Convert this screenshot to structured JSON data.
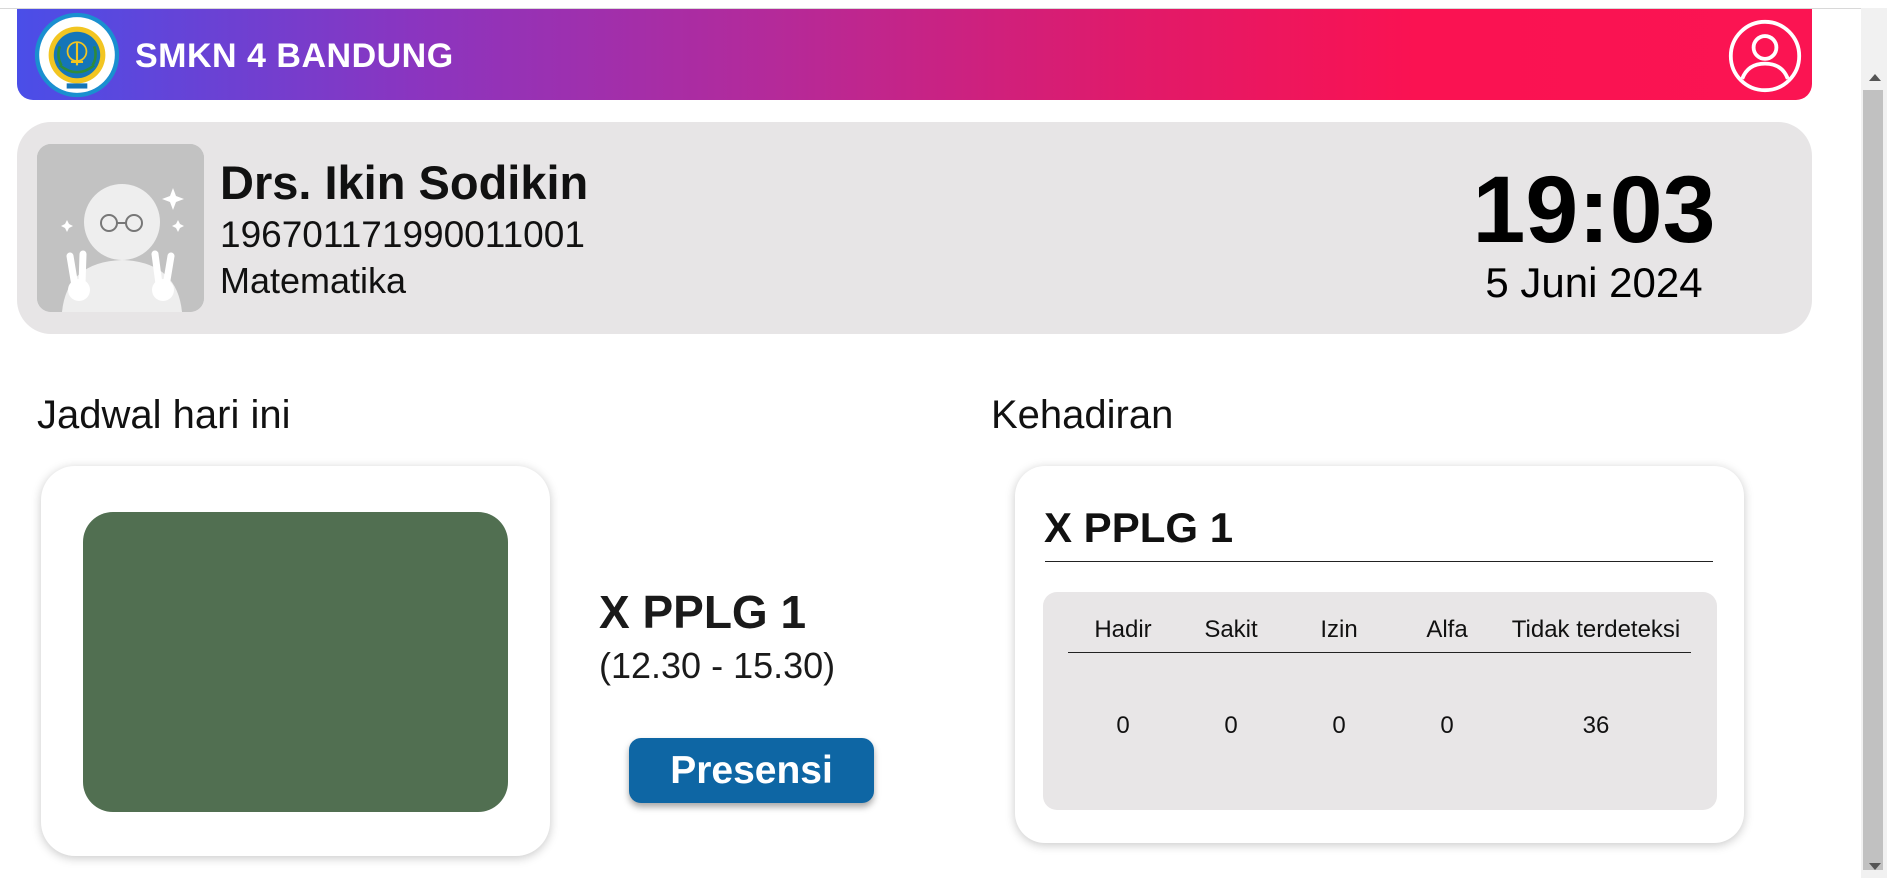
{
  "header": {
    "school_name": "SMKN 4 BANDUNG",
    "logo_icon": "school-seal-logo",
    "profile_icon": "user-circle-icon",
    "colors": {
      "gradient_start": "#4a4ee8",
      "gradient_mid": "#b42a9a",
      "gradient_end": "#fb1452"
    }
  },
  "teacher": {
    "name": "Drs. Ikin Sodikin",
    "nip": "196701171990011001",
    "subject": "Matematika",
    "avatar_icon": "avatar-placeholder-icon"
  },
  "clock": {
    "time": "19:03",
    "date": "5 Juni 2024"
  },
  "schedule": {
    "title": "Jadwal hari ini",
    "class_name": "X PPLG 1",
    "time_range": "(12.30 - 15.30)",
    "button_label": "Presensi",
    "thumb_color": "#516f51",
    "button_color": "#0e66a4"
  },
  "attendance": {
    "title": "Kehadiran",
    "class_name": "X PPLG 1",
    "columns": [
      "Hadir",
      "Sakit",
      "Izin",
      "Alfa",
      "Tidak terdeteksi"
    ],
    "values": [
      "0",
      "0",
      "0",
      "0",
      "36"
    ]
  }
}
